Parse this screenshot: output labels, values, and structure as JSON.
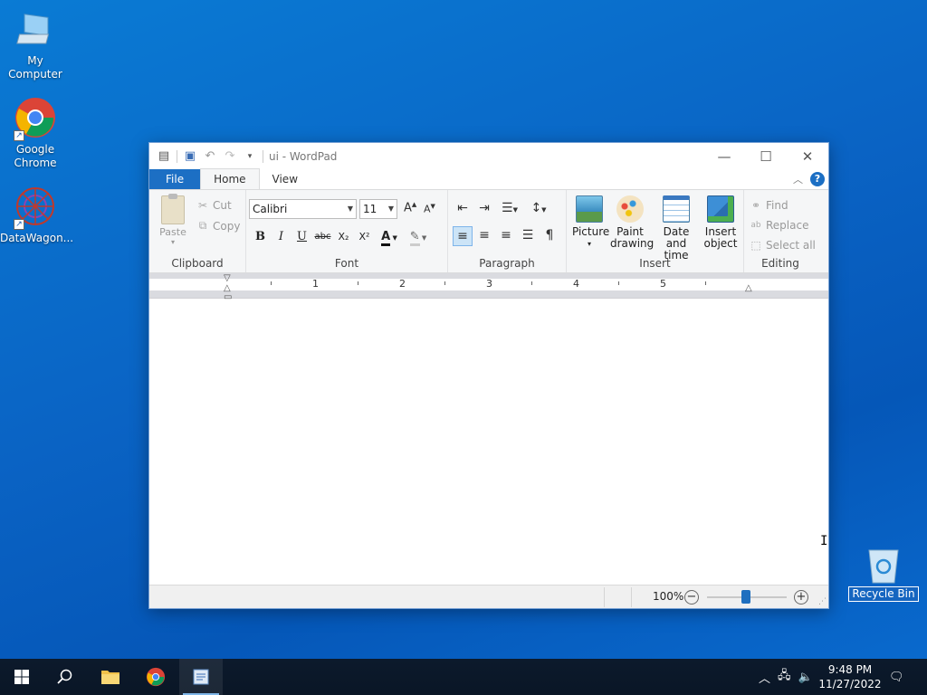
{
  "desktop": {
    "icons": [
      {
        "label": "My Computer",
        "icon": "computer-icon"
      },
      {
        "label": "Google Chrome",
        "icon": "chrome-icon"
      },
      {
        "label": "DataWagon...",
        "icon": "datawagon-icon"
      },
      {
        "label": "Recycle Bin",
        "icon": "recycle-bin-icon"
      }
    ]
  },
  "window": {
    "title": "ui - WordPad",
    "tabs": {
      "file": "File",
      "home": "Home",
      "view": "View"
    },
    "help": "?",
    "ribbon": {
      "clipboard": {
        "label": "Clipboard",
        "paste": "Paste",
        "cut": "Cut",
        "copy": "Copy"
      },
      "font": {
        "label": "Font",
        "family": "Calibri",
        "size": "11"
      },
      "paragraph": {
        "label": "Paragraph"
      },
      "insert": {
        "label": "Insert",
        "picture": "Picture",
        "paint_line1": "Paint",
        "paint_line2": "drawing",
        "date_line1": "Date and",
        "date_line2": "time",
        "object_line1": "Insert",
        "object_line2": "object"
      },
      "editing": {
        "label": "Editing",
        "find": "Find",
        "replace": "Replace",
        "select_all": "Select all"
      }
    },
    "ruler": {
      "numbers": [
        "1",
        "2",
        "3",
        "4",
        "5"
      ]
    },
    "status": {
      "zoom": "100%",
      "zoom_level": 1.0
    }
  },
  "taskbar": {
    "time": "9:48 PM",
    "date": "11/27/2022"
  },
  "colors": {
    "accent": "#1c6fc4",
    "desktop": "#0a63c4",
    "taskbar": "#0c1a2c"
  }
}
